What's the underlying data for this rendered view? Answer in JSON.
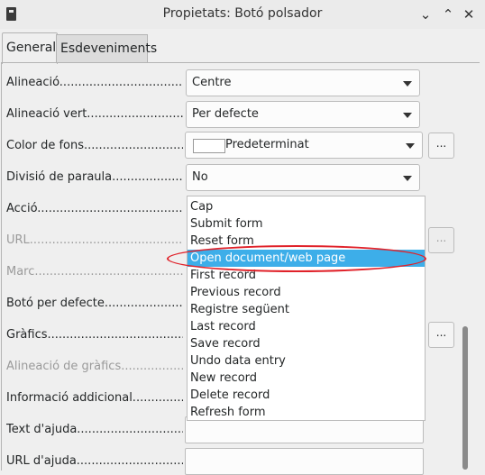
{
  "window": {
    "title": "Propietats: Botó polsador",
    "controls": {
      "collapse": "⌄",
      "maximize": "⌃",
      "close": "✕"
    }
  },
  "tabs": [
    {
      "label": "General",
      "active": true
    },
    {
      "label": "Esdeveniments",
      "active": false
    }
  ],
  "fields": {
    "alineacio": {
      "label": "Alineació..........................................",
      "value": "Centre"
    },
    "alineacio_vert": {
      "label": "Alineació vert...................................",
      "value": "Per defecte"
    },
    "color_fons": {
      "label": "Color de fons.....................................",
      "value": "Predeterminat",
      "button": "..."
    },
    "divisio_paraula": {
      "label": "Divisió de paraula...............................",
      "value": "No"
    },
    "accio": {
      "label": "Acció..............................................."
    },
    "url": {
      "label": "URL.................................................",
      "button": "..."
    },
    "marc": {
      "label": "Marc................................................."
    },
    "boto_defecte": {
      "label": "Botó per defecte..................................."
    },
    "grafics": {
      "label": "Gràfics..............................................",
      "button": "..."
    },
    "alineacio_grafics": {
      "label": "Alineació de gràfics............................"
    },
    "informacio_addicional": {
      "label": "Informació addicional..........................."
    },
    "text_ajuda": {
      "label": "Text d'ajuda........................................"
    },
    "url_ajuda": {
      "label": "URL d'ajuda........................................"
    }
  },
  "dropdown": {
    "items": [
      "Cap",
      "Submit form",
      "Reset form",
      "Open document/web page",
      "First record",
      "Previous record",
      "Registre següent",
      "Last record",
      "Save record",
      "Undo data entry",
      "New record",
      "Delete record",
      "Refresh form"
    ],
    "selected_index": 3
  },
  "colors": {
    "selection": "#3daee9",
    "highlight_ellipse": "#e0222a"
  }
}
